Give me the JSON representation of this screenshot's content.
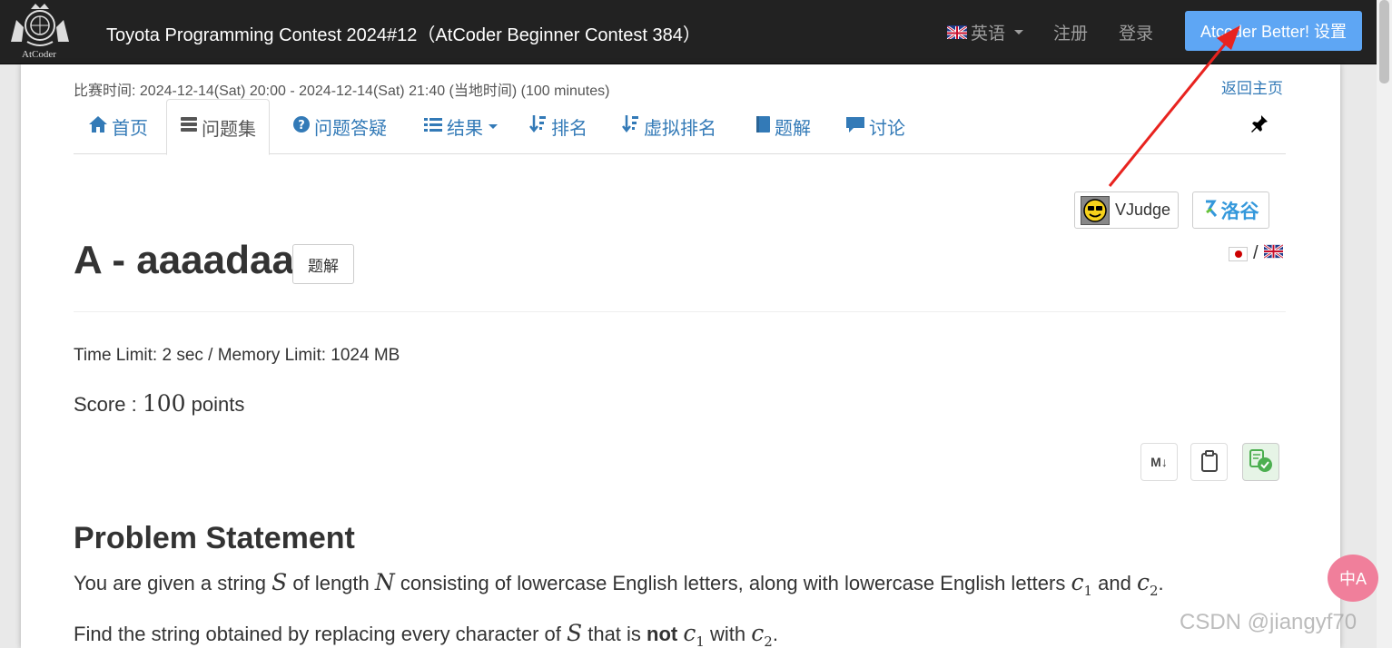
{
  "navbar": {
    "logo_text": "AtCoder",
    "contest_title": "Toyota Programming Contest 2024#12（AtCoder Beginner Contest 384）",
    "language": "英语",
    "register": "注册",
    "login": "登录",
    "better_button": "Atcoder Better! 设置"
  },
  "header": {
    "contest_time": "比赛时间: 2024-12-14(Sat) 20:00 - 2024-12-14(Sat) 21:40 (当地时间) (100 minutes)",
    "back_home": "返回主页"
  },
  "tabs": [
    {
      "label": "首页",
      "icon": "home-icon"
    },
    {
      "label": "问题集",
      "icon": "tasks-icon",
      "active": true
    },
    {
      "label": "问题答疑",
      "icon": "question-icon"
    },
    {
      "label": "结果",
      "icon": "list-icon",
      "dropdown": true
    },
    {
      "label": "排名",
      "icon": "sort-icon"
    },
    {
      "label": "虚拟排名",
      "icon": "sort-icon"
    },
    {
      "label": "题解",
      "icon": "book-icon"
    },
    {
      "label": "讨论",
      "icon": "comment-icon"
    }
  ],
  "external": {
    "vjudge": "VJudge",
    "luogu": "洛谷",
    "lang_separator": "/"
  },
  "problem": {
    "title": "A - aaaadaa",
    "editorial_button": "题解",
    "limits": "Time Limit: 2 sec / Memory Limit: 1024 MB",
    "score_label": "Score : ",
    "score_value": "100",
    "score_unit": " points",
    "section_title": "Problem Statement",
    "p1_a": "You are given a string ",
    "p1_S": "S",
    "p1_b": " of length ",
    "p1_N": "N",
    "p1_c": " consisting of lowercase English letters, along with lowercase English letters ",
    "p1_c1": "c",
    "p1_c1_sub": "1",
    "p1_d": " and ",
    "p1_c2": "c",
    "p1_c2_sub": "2",
    "p1_e": ".",
    "p2_a": "Find the string obtained by replacing every character of ",
    "p2_S": "S",
    "p2_b": " that is ",
    "p2_not": "not",
    "p2_c1": "c",
    "p2_c1_sub": "1",
    "p2_c": " with ",
    "p2_c2": "c",
    "p2_c2_sub": "2",
    "p2_d": "."
  },
  "tools": {
    "markdown": "M↓"
  },
  "overlay": {
    "translate": "中A",
    "watermark": "CSDN @jiangyf70",
    "arrow_color": "#e8231f"
  }
}
